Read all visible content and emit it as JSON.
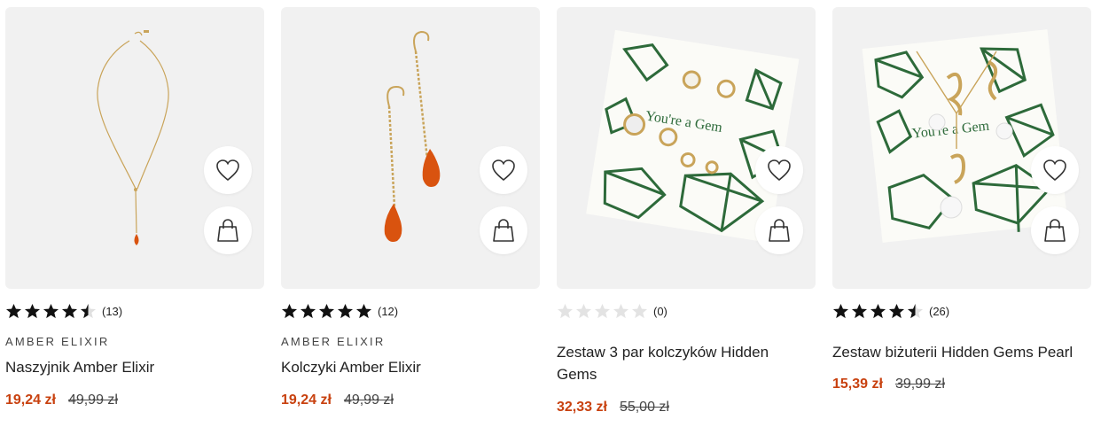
{
  "products": [
    {
      "brand": "AMBER ELIXIR",
      "name": "Naszyjnik Amber Elixir",
      "rating": 4.5,
      "reviews": "(13)",
      "price": "19,24 zł",
      "old_price": "49,99 zł"
    },
    {
      "brand": "AMBER ELIXIR",
      "name": "Kolczyki Amber Elixir",
      "rating": 5,
      "reviews": "(12)",
      "price": "19,24 zł",
      "old_price": "49,99 zł"
    },
    {
      "brand": "",
      "name": "Zestaw 3 par kolczyków Hidden Gems",
      "rating": 0,
      "reviews": "(0)",
      "price": "32,33 zł",
      "old_price": "55,00 zł",
      "card_text": "You're a Gem"
    },
    {
      "brand": "",
      "name": "Zestaw biżuterii Hidden Gems Pearl",
      "rating": 4.5,
      "reviews": "(26)",
      "price": "15,39 zł",
      "old_price": "39,99 zł",
      "card_text": "You're a Gem"
    }
  ],
  "icons": {
    "wishlist": "heart-icon",
    "cart": "shopping-bag-icon",
    "rating": "star-icon"
  },
  "colors": {
    "price": "#c8410f",
    "amber": "#d9530f",
    "gold": "#c9a45a",
    "gem_green": "#2d6a3a"
  }
}
